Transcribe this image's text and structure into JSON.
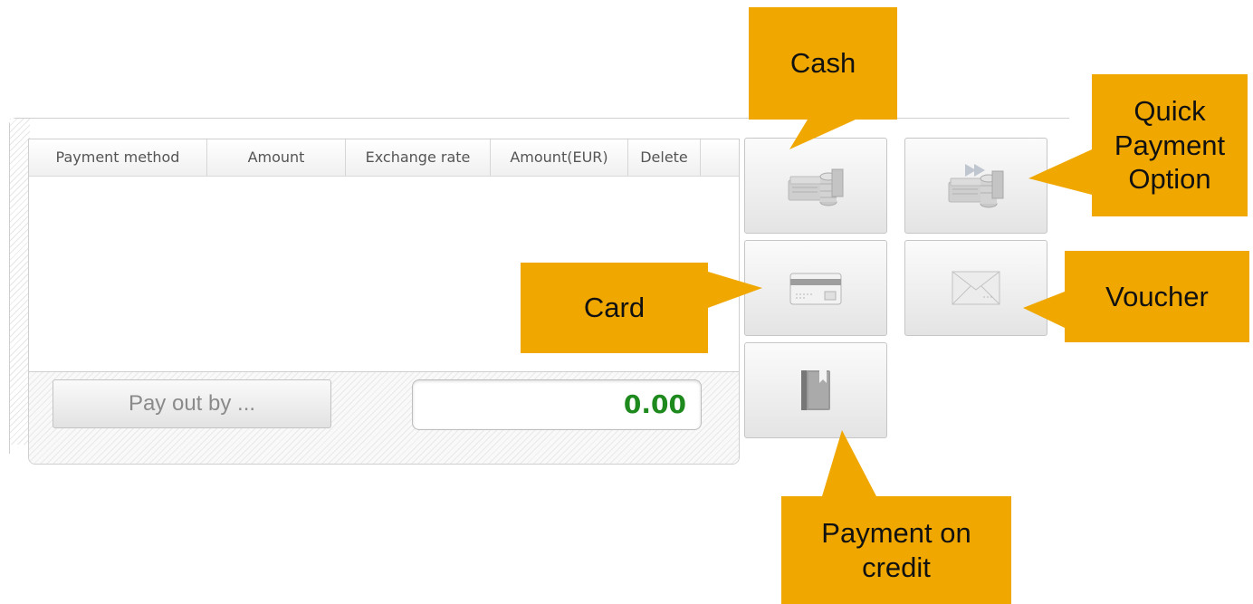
{
  "payments_table": {
    "columns": [
      "Payment method",
      "Amount",
      "Exchange rate",
      "Amount(EUR)",
      "Delete"
    ],
    "rows": []
  },
  "footer": {
    "pay_out_button": "Pay out by ...",
    "total_amount": "0.00"
  },
  "payment_buttons": [
    {
      "name": "cash",
      "icon": "cash-icon"
    },
    {
      "name": "quick-payment",
      "icon": "quick-payment-icon"
    },
    {
      "name": "card",
      "icon": "card-icon"
    },
    {
      "name": "voucher",
      "icon": "voucher-icon"
    },
    {
      "name": "payment-on-credit",
      "icon": "book-icon"
    }
  ],
  "callouts": {
    "cash": "Cash",
    "quick_payment": "Quick Payment Option",
    "card": "Card",
    "voucher": "Voucher",
    "payment_on_credit": "Payment on credit"
  },
  "colors": {
    "callout": "#f0a800",
    "total_text": "#1e8a1e"
  }
}
